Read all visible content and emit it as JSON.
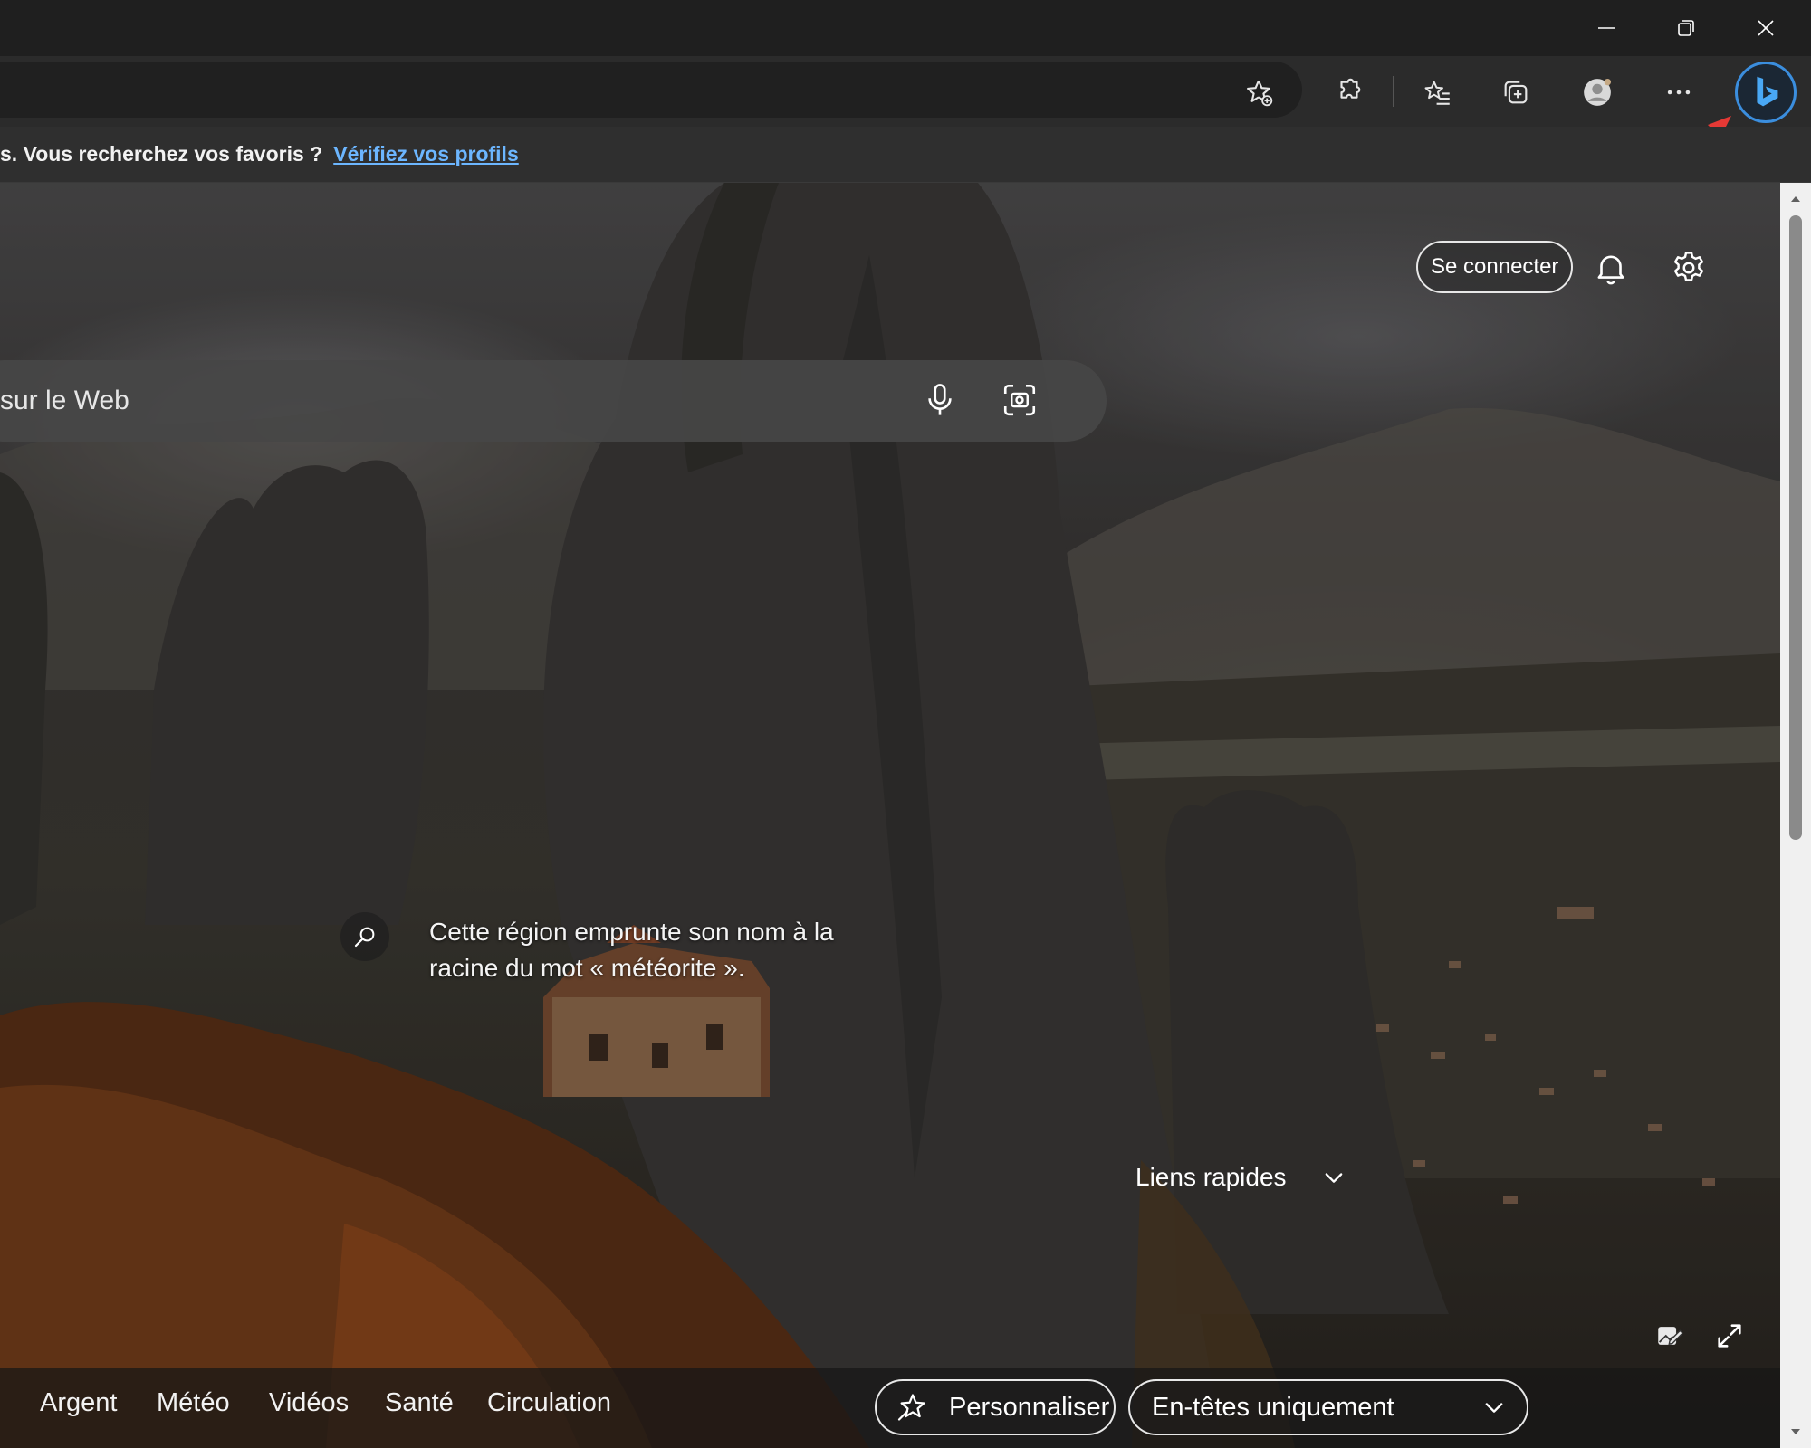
{
  "window": {
    "minimize_icon": "minimize-icon",
    "restore_icon": "restore-icon",
    "close_icon": "close-icon"
  },
  "toolbar": {
    "icons": [
      "add-favorite-icon",
      "extensions-icon",
      "favorites-icon",
      "collections-icon",
      "profile-icon",
      "more-icon",
      "bing-copilot-icon"
    ],
    "accent_color": "#3b8ede"
  },
  "infobar": {
    "message": "s. Vous recherchez vos favoris ?",
    "link": "Vérifiez vos profils",
    "link_color": "#6cb6ff"
  },
  "header": {
    "signin_label": "Se connecter"
  },
  "search": {
    "placeholder": "sur le Web"
  },
  "fact": {
    "text": "Cette région emprunte son nom à la racine du mot « météorite »."
  },
  "quick_links": {
    "label": "Liens rapides"
  },
  "bottom_nav": {
    "items": [
      "Argent",
      "Météo",
      "Vidéos",
      "Santé",
      "Circulation"
    ],
    "personalize_label": "Personnaliser",
    "view_select_value": "En-têtes uniquement"
  },
  "annotation": {
    "color": "#e53935"
  }
}
